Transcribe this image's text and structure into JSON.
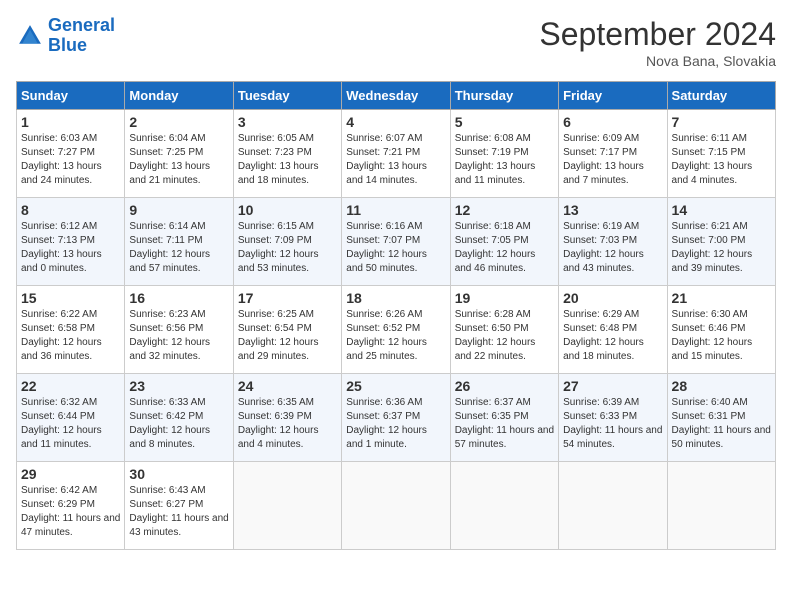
{
  "header": {
    "logo_line1": "General",
    "logo_line2": "Blue",
    "month_title": "September 2024",
    "location": "Nova Bana, Slovakia"
  },
  "days_of_week": [
    "Sunday",
    "Monday",
    "Tuesday",
    "Wednesday",
    "Thursday",
    "Friday",
    "Saturday"
  ],
  "weeks": [
    [
      {
        "day": 1,
        "info": "Sunrise: 6:03 AM\nSunset: 7:27 PM\nDaylight: 13 hours and 24 minutes."
      },
      {
        "day": 2,
        "info": "Sunrise: 6:04 AM\nSunset: 7:25 PM\nDaylight: 13 hours and 21 minutes."
      },
      {
        "day": 3,
        "info": "Sunrise: 6:05 AM\nSunset: 7:23 PM\nDaylight: 13 hours and 18 minutes."
      },
      {
        "day": 4,
        "info": "Sunrise: 6:07 AM\nSunset: 7:21 PM\nDaylight: 13 hours and 14 minutes."
      },
      {
        "day": 5,
        "info": "Sunrise: 6:08 AM\nSunset: 7:19 PM\nDaylight: 13 hours and 11 minutes."
      },
      {
        "day": 6,
        "info": "Sunrise: 6:09 AM\nSunset: 7:17 PM\nDaylight: 13 hours and 7 minutes."
      },
      {
        "day": 7,
        "info": "Sunrise: 6:11 AM\nSunset: 7:15 PM\nDaylight: 13 hours and 4 minutes."
      }
    ],
    [
      {
        "day": 8,
        "info": "Sunrise: 6:12 AM\nSunset: 7:13 PM\nDaylight: 13 hours and 0 minutes."
      },
      {
        "day": 9,
        "info": "Sunrise: 6:14 AM\nSunset: 7:11 PM\nDaylight: 12 hours and 57 minutes."
      },
      {
        "day": 10,
        "info": "Sunrise: 6:15 AM\nSunset: 7:09 PM\nDaylight: 12 hours and 53 minutes."
      },
      {
        "day": 11,
        "info": "Sunrise: 6:16 AM\nSunset: 7:07 PM\nDaylight: 12 hours and 50 minutes."
      },
      {
        "day": 12,
        "info": "Sunrise: 6:18 AM\nSunset: 7:05 PM\nDaylight: 12 hours and 46 minutes."
      },
      {
        "day": 13,
        "info": "Sunrise: 6:19 AM\nSunset: 7:03 PM\nDaylight: 12 hours and 43 minutes."
      },
      {
        "day": 14,
        "info": "Sunrise: 6:21 AM\nSunset: 7:00 PM\nDaylight: 12 hours and 39 minutes."
      }
    ],
    [
      {
        "day": 15,
        "info": "Sunrise: 6:22 AM\nSunset: 6:58 PM\nDaylight: 12 hours and 36 minutes."
      },
      {
        "day": 16,
        "info": "Sunrise: 6:23 AM\nSunset: 6:56 PM\nDaylight: 12 hours and 32 minutes."
      },
      {
        "day": 17,
        "info": "Sunrise: 6:25 AM\nSunset: 6:54 PM\nDaylight: 12 hours and 29 minutes."
      },
      {
        "day": 18,
        "info": "Sunrise: 6:26 AM\nSunset: 6:52 PM\nDaylight: 12 hours and 25 minutes."
      },
      {
        "day": 19,
        "info": "Sunrise: 6:28 AM\nSunset: 6:50 PM\nDaylight: 12 hours and 22 minutes."
      },
      {
        "day": 20,
        "info": "Sunrise: 6:29 AM\nSunset: 6:48 PM\nDaylight: 12 hours and 18 minutes."
      },
      {
        "day": 21,
        "info": "Sunrise: 6:30 AM\nSunset: 6:46 PM\nDaylight: 12 hours and 15 minutes."
      }
    ],
    [
      {
        "day": 22,
        "info": "Sunrise: 6:32 AM\nSunset: 6:44 PM\nDaylight: 12 hours and 11 minutes."
      },
      {
        "day": 23,
        "info": "Sunrise: 6:33 AM\nSunset: 6:42 PM\nDaylight: 12 hours and 8 minutes."
      },
      {
        "day": 24,
        "info": "Sunrise: 6:35 AM\nSunset: 6:39 PM\nDaylight: 12 hours and 4 minutes."
      },
      {
        "day": 25,
        "info": "Sunrise: 6:36 AM\nSunset: 6:37 PM\nDaylight: 12 hours and 1 minute."
      },
      {
        "day": 26,
        "info": "Sunrise: 6:37 AM\nSunset: 6:35 PM\nDaylight: 11 hours and 57 minutes."
      },
      {
        "day": 27,
        "info": "Sunrise: 6:39 AM\nSunset: 6:33 PM\nDaylight: 11 hours and 54 minutes."
      },
      {
        "day": 28,
        "info": "Sunrise: 6:40 AM\nSunset: 6:31 PM\nDaylight: 11 hours and 50 minutes."
      }
    ],
    [
      {
        "day": 29,
        "info": "Sunrise: 6:42 AM\nSunset: 6:29 PM\nDaylight: 11 hours and 47 minutes."
      },
      {
        "day": 30,
        "info": "Sunrise: 6:43 AM\nSunset: 6:27 PM\nDaylight: 11 hours and 43 minutes."
      },
      null,
      null,
      null,
      null,
      null
    ]
  ]
}
